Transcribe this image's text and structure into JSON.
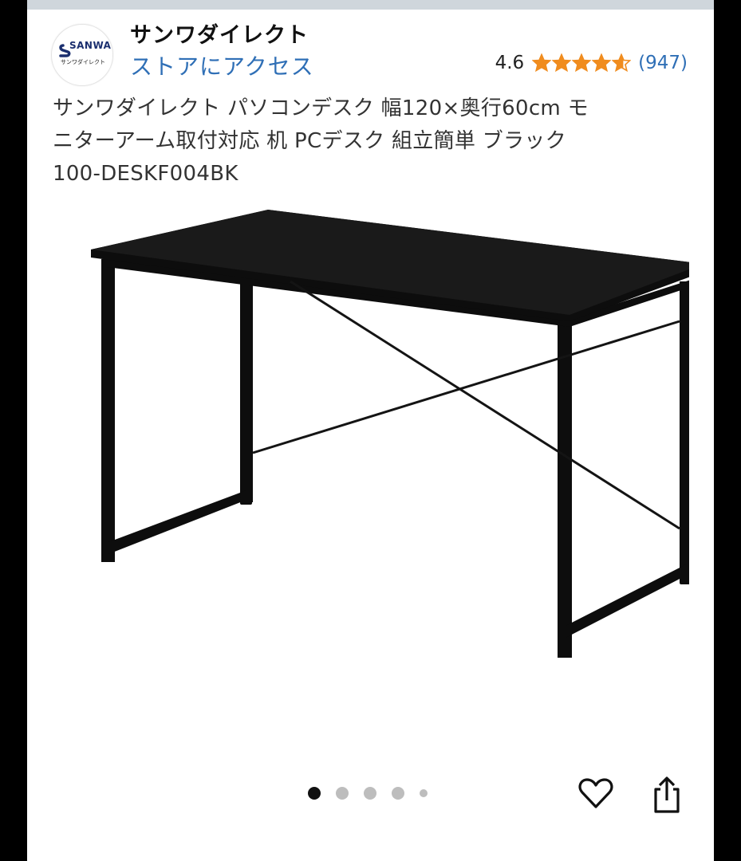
{
  "store": {
    "logo_brand": "SANWA",
    "logo_sub": "サンワダイレクト",
    "name": "サンワダイレクト",
    "link_label": "ストアにアクセス"
  },
  "rating": {
    "value": "4.6",
    "stars_value": 4.6,
    "stars_max": 5,
    "count": "(947)",
    "star_color": "#f08c1e"
  },
  "product": {
    "title_line1": "サンワダイレクト パソコンデスク 幅120×奥行60cm モ",
    "title_line2": "ニターアーム取付対応 机 PCデスク 組立簡単 ブラック",
    "title_line3": "100-DESKF004BK",
    "image_icon": "black-desk-photo"
  },
  "carousel": {
    "total": 5,
    "active_index": 0
  },
  "actions": {
    "favorite_icon": "heart-icon",
    "share_icon": "share-icon"
  },
  "colors": {
    "link": "#2f6fb6",
    "text": "#333333",
    "bezel": "#000000"
  }
}
